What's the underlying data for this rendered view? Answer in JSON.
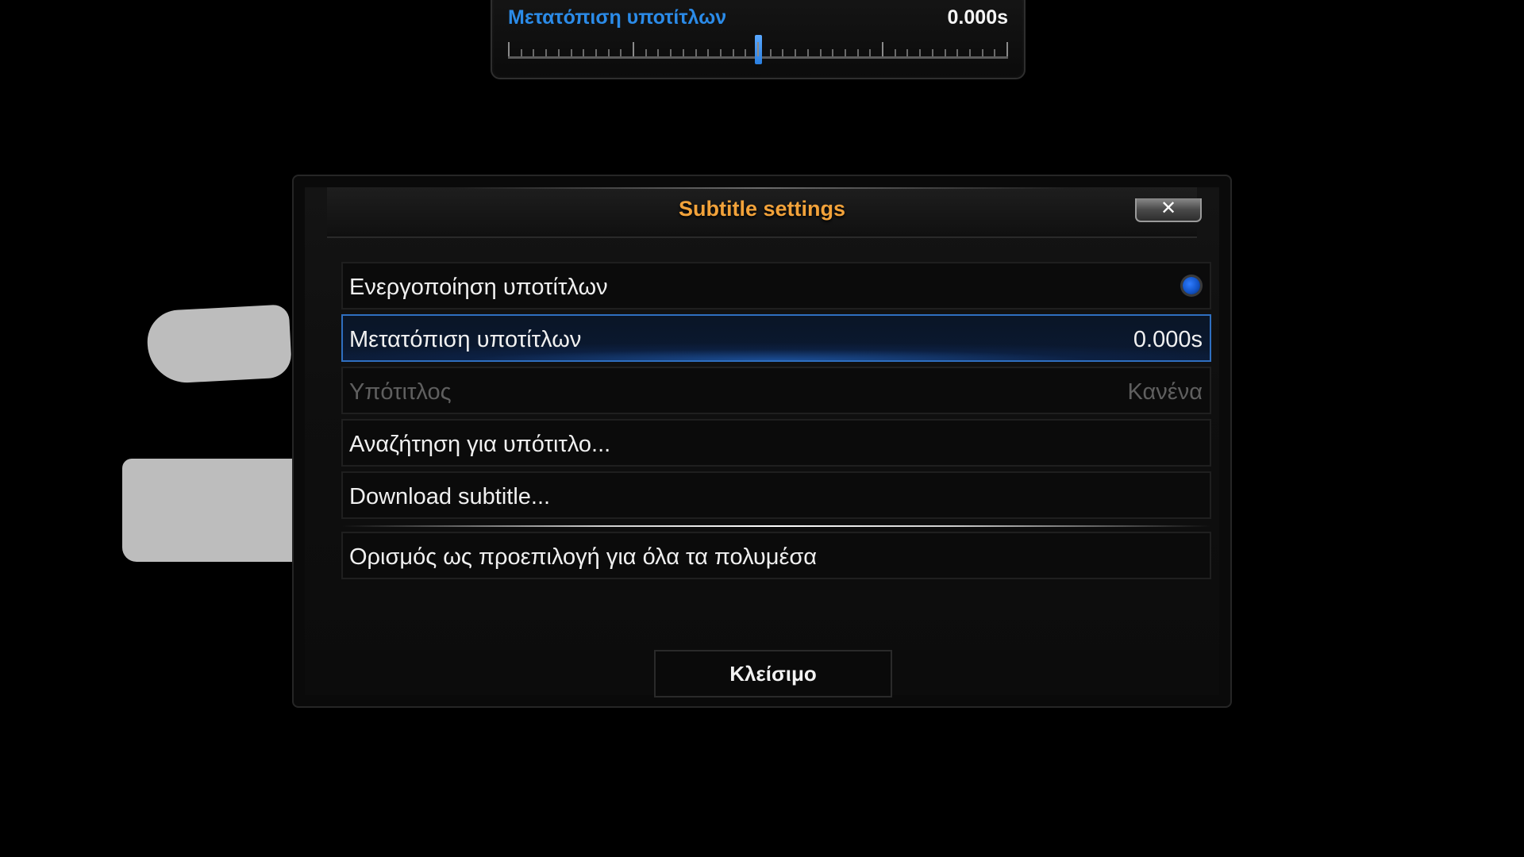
{
  "osd": {
    "label": "Μετατόπιση υποτίτλων",
    "value": "0.000s",
    "slider_fraction": 0.5
  },
  "dialog": {
    "title": "Subtitle settings",
    "close_icon": "✕",
    "rows": [
      {
        "label": "Ενεργοποίηση υποτίτλων",
        "control": "radio",
        "checked": true
      },
      {
        "label": "Μετατόπιση υποτίτλων",
        "value": "0.000s",
        "focused": true
      },
      {
        "label": "Υπότιτλος",
        "value": "Κανένα",
        "disabled": true
      },
      {
        "label": "Αναζήτηση για υπότιτλο..."
      },
      {
        "label": "Download subtitle..."
      },
      {
        "label": "Ορισμός ως προεπιλογή για όλα τα πολυμέσα"
      }
    ],
    "close_button": "Κλείσιμο"
  },
  "colors": {
    "accent_blue": "#2b8be8",
    "title_orange": "#f2a23a",
    "focus_border": "#2f6fc0"
  }
}
